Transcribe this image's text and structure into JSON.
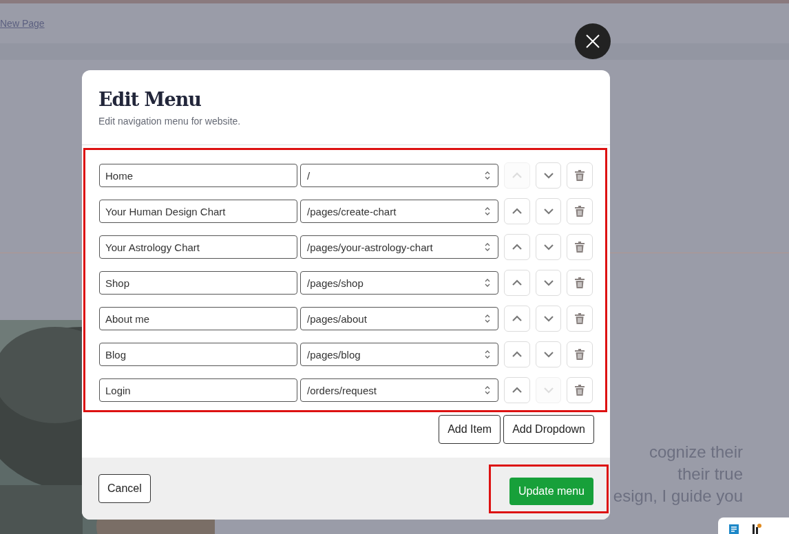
{
  "background": {
    "link": "New Page",
    "text_lines": [
      "cognize their",
      "their true",
      "esign, I guide you"
    ]
  },
  "dialog": {
    "title": "Edit Menu",
    "subtitle": "Edit navigation menu for website.",
    "items": [
      {
        "label": "Home",
        "url": "/",
        "up_disabled": true,
        "down_disabled": false
      },
      {
        "label": "Your Human Design Chart",
        "url": "/pages/create-chart",
        "up_disabled": false,
        "down_disabled": false
      },
      {
        "label": "Your Astrology Chart",
        "url": "/pages/your-astrology-chart",
        "up_disabled": false,
        "down_disabled": false
      },
      {
        "label": "Shop",
        "url": "/pages/shop",
        "up_disabled": false,
        "down_disabled": false
      },
      {
        "label": "About me",
        "url": "/pages/about",
        "up_disabled": false,
        "down_disabled": false
      },
      {
        "label": "Blog",
        "url": "/pages/blog",
        "up_disabled": false,
        "down_disabled": false
      },
      {
        "label": "Login",
        "url": "/orders/request",
        "up_disabled": false,
        "down_disabled": true
      }
    ],
    "add_buttons": [
      "Add Item",
      "Add Dropdown"
    ],
    "cancel": "Cancel",
    "submit": "Update menu",
    "highlight_items": true,
    "highlight_submit": true
  }
}
